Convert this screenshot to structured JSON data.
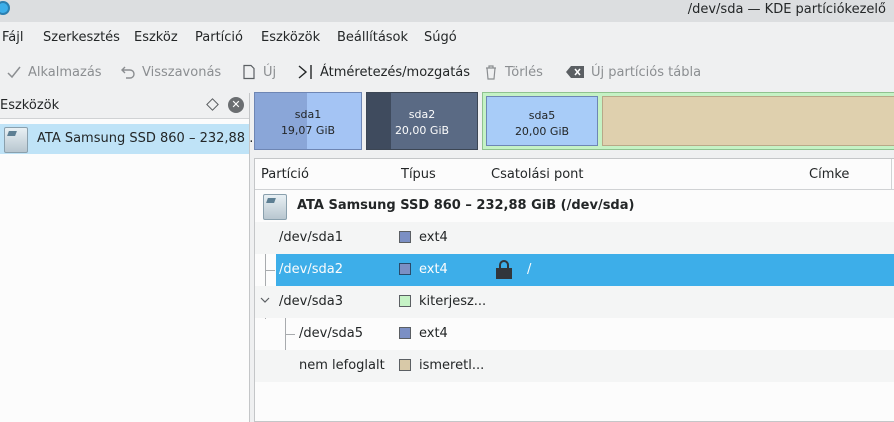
{
  "window": {
    "title": "/dev/sda — KDE partíciókezelő"
  },
  "menu": [
    "Fájl",
    "Szerkesztés",
    "Eszköz",
    "Partíció",
    "Eszközök",
    "Beállítások",
    "Súgó"
  ],
  "toolbar": {
    "apply": "Alkalmazás",
    "undo": "Visszavonás",
    "new": "Új",
    "resize": "Átméretezés/mozgatás",
    "delete": "Törlés",
    "new_table": "Új partíciós tábla"
  },
  "devices_panel": {
    "title": "Eszközök",
    "device": "ATA Samsung SSD 860 – 232,88 ..."
  },
  "partition_bar": [
    {
      "name": "sda1",
      "size": "19,07 GiB"
    },
    {
      "name": "sda2",
      "size": "20,00 GiB"
    },
    {
      "name": "sda5",
      "size": "20,00 GiB"
    }
  ],
  "table": {
    "columns": [
      "Partíció",
      "Típus",
      "Csatolási pont",
      "Címke"
    ],
    "device_row": "ATA Samsung SSD 860 – 232,88 GiB (/dev/sda)",
    "rows": [
      {
        "partition": "/dev/sda1",
        "type": "ext4",
        "mount": "",
        "color": "#7b8fc4"
      },
      {
        "partition": "/dev/sda2",
        "type": "ext4",
        "mount": "/",
        "color": "#7b8fc4",
        "selected": true,
        "locked": true
      },
      {
        "partition": "/dev/sda3",
        "type": "kiterjesz...",
        "mount": "",
        "color": "#c5f2c5"
      },
      {
        "partition": "/dev/sda5",
        "type": "ext4",
        "mount": "",
        "color": "#7b8fc4"
      },
      {
        "partition": "nem lefoglalt",
        "type": "ismeretl...",
        "mount": "",
        "color": "#d8c9a8"
      }
    ]
  },
  "colors": {
    "selection": "#3daee9",
    "ext4": "#7b8fc4",
    "extended": "#c5f2c5",
    "unallocated": "#d8c9a8"
  }
}
